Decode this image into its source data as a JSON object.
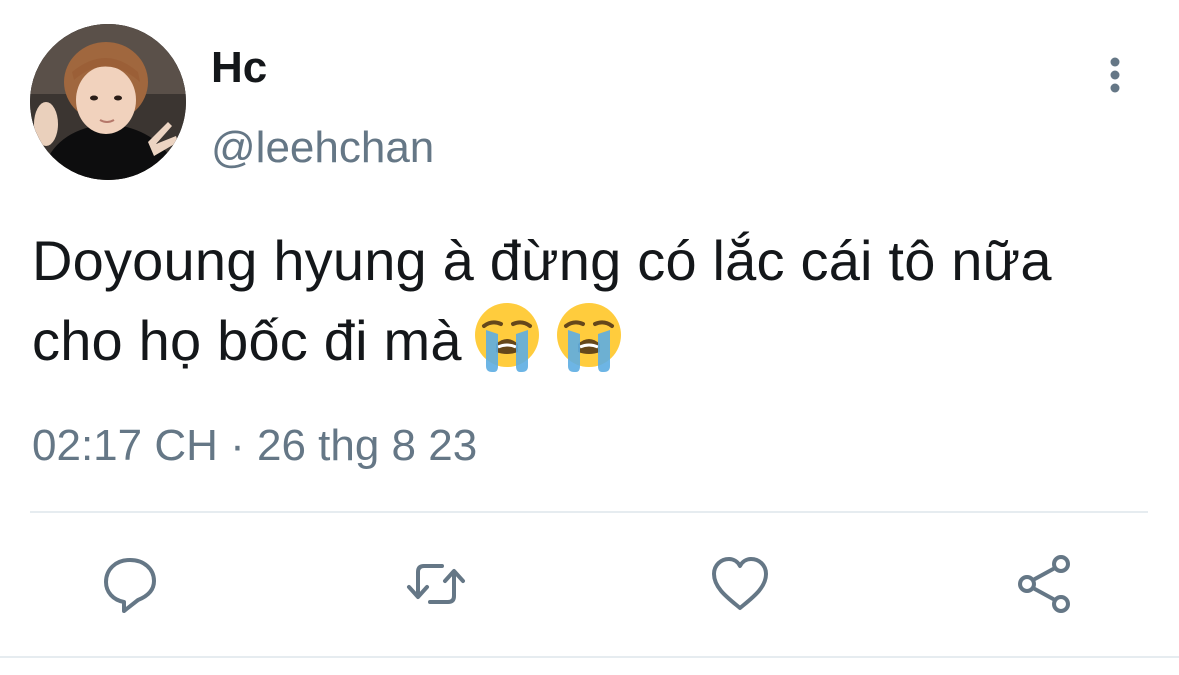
{
  "tweet": {
    "display_name": "Hc",
    "handle": "@leehchan",
    "text": "Doyoung hyung à đừng có lắc cái tô nữa cho họ bốc đi mà",
    "emojis": [
      "loudly-crying-face",
      "loudly-crying-face"
    ],
    "timestamp": "02:17 CH · 26 thg 8 23"
  },
  "actions": [
    "reply-icon",
    "retweet-icon",
    "like-icon",
    "share-icon"
  ],
  "colors": {
    "text": "#14171a",
    "secondary": "#657786",
    "icon": "#657786",
    "divider": "#e6ecf0"
  }
}
